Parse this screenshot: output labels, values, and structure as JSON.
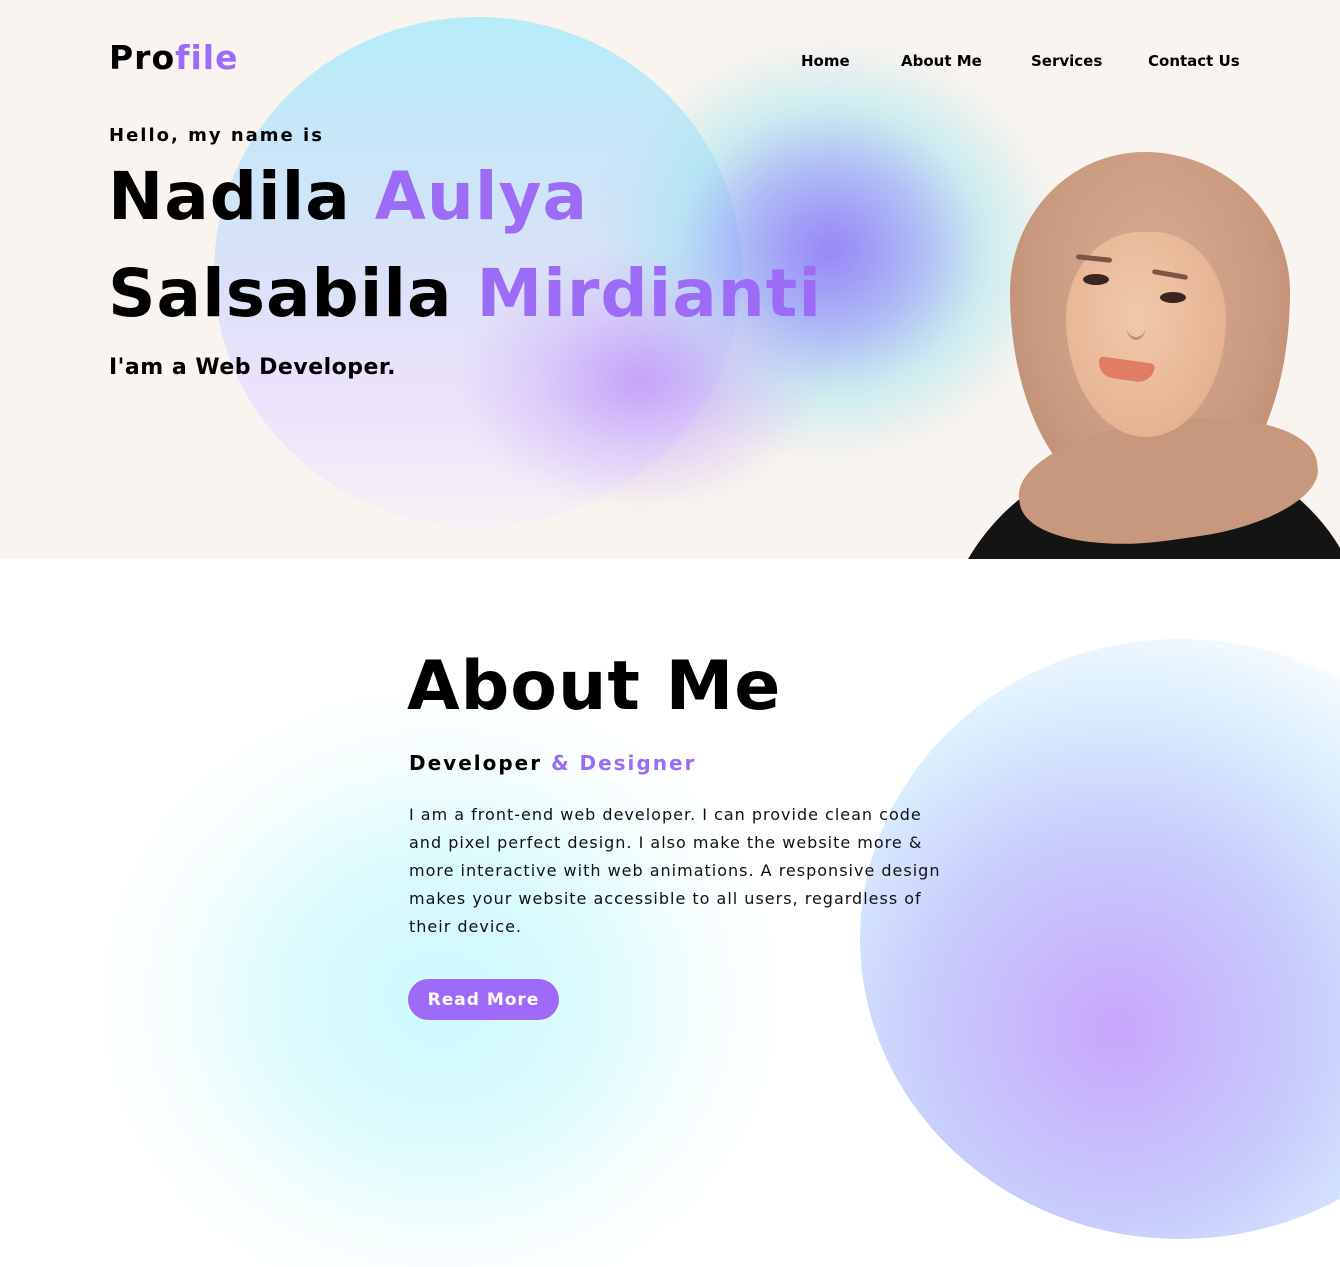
{
  "header": {
    "logo_part1": "Pro",
    "logo_part2": "file",
    "nav": [
      "Home",
      "About Me",
      "Services",
      "Contact Us"
    ]
  },
  "hero": {
    "greeting": "Hello, my name is",
    "name_first": "Nadila",
    "name_first_accent": "Aulya",
    "name_second": "Salsabila",
    "name_second_accent": "Mirdianti",
    "role": "I'am a Web Developer."
  },
  "about": {
    "title": "About Me",
    "subtitle_main": "Developer",
    "subtitle_accent": "& Designer",
    "paragraph": "I am a front-end web developer. I can provide clean code and pixel perfect design. I also make the website more & more interactive with web animations. A responsive design makes your website accessible to all users, regardless of their device.",
    "button_label": "Read More"
  },
  "colors": {
    "accent": "#9c6cf7",
    "button": "#a06af8",
    "hero_bg": "#f9f4ef"
  }
}
